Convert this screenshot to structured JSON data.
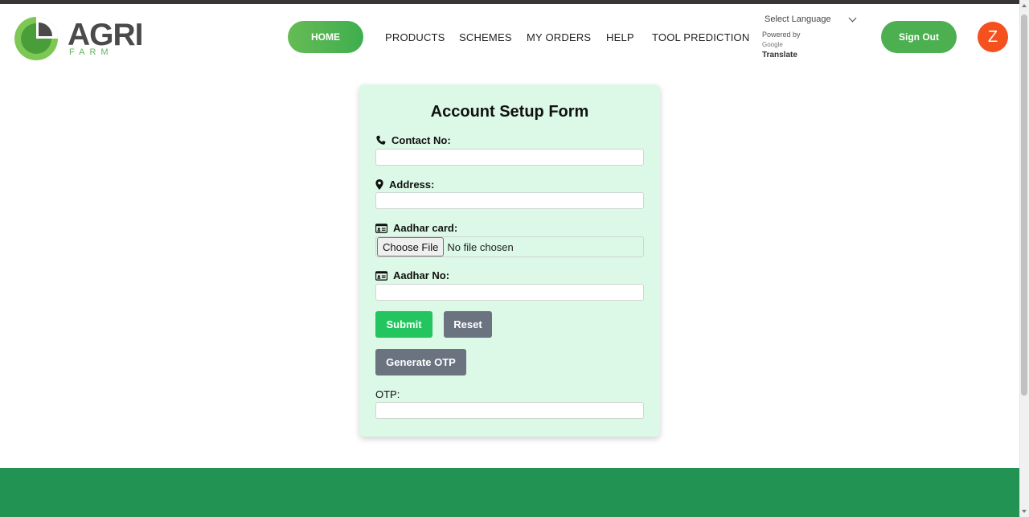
{
  "brand": {
    "name": "AGRI",
    "tagline": "FARM"
  },
  "nav": {
    "home": "HOME",
    "products": "PRODUCTS",
    "schemes": "SCHEMES",
    "my_orders": "MY ORDERS",
    "help": "HELP",
    "tool_prediction": "TOOL PREDICTION"
  },
  "translate": {
    "select_language": "Select Language",
    "powered_by": "Powered by",
    "google": "Google",
    "translate": "Translate"
  },
  "user": {
    "sign_out": "Sign Out",
    "avatar_initial": "Z"
  },
  "form": {
    "title": "Account Setup Form",
    "contact_label": "Contact No:",
    "contact_value": "",
    "address_label": "Address:",
    "address_value": "",
    "aadhar_card_label": "Aadhar card:",
    "choose_file": "Choose File",
    "file_status": "No file chosen",
    "aadhar_no_label": "Aadhar No:",
    "aadhar_no_value": "",
    "submit": "Submit",
    "reset": "Reset",
    "generate_otp": "Generate OTP",
    "otp_label": "OTP:",
    "otp_value": ""
  },
  "icons": {
    "contact": "phone-icon",
    "address": "map-marker-icon",
    "aadhar_card": "id-card-icon",
    "aadhar_no": "id-card-icon"
  },
  "colors": {
    "primary_green": "#4caf50",
    "submit_green": "#22c55e",
    "secondary_gray": "#6b7280",
    "form_background": "#dcf8e6",
    "footer_green": "#239354",
    "avatar_orange": "#f4511e"
  }
}
